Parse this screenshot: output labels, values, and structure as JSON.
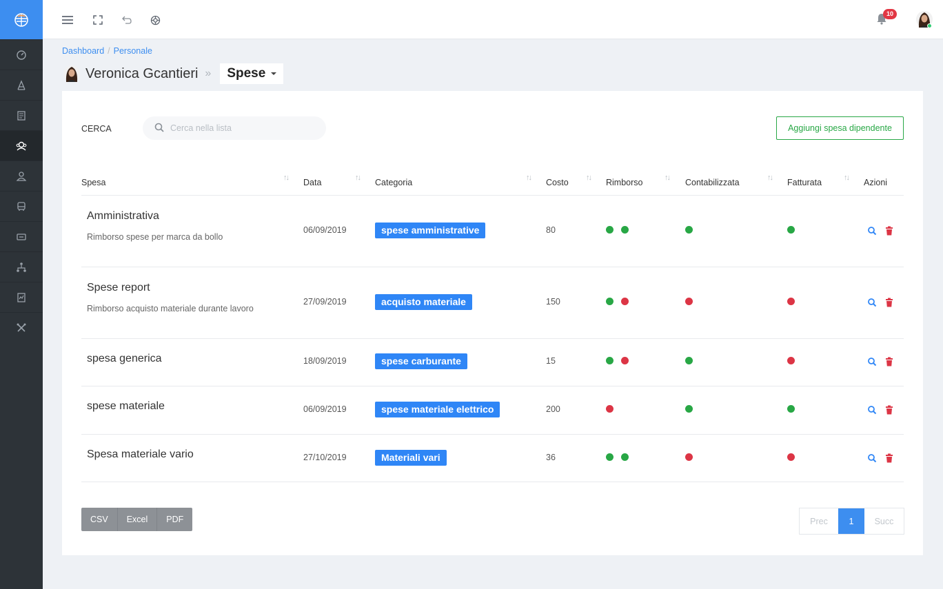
{
  "sidebar": {
    "logo": "logo-icon",
    "items": [
      {
        "icon": "dashboard-icon"
      },
      {
        "icon": "text-icon"
      },
      {
        "icon": "document-icon"
      },
      {
        "icon": "team-icon",
        "active": true
      },
      {
        "icon": "user-group-icon"
      },
      {
        "icon": "vehicle-icon"
      },
      {
        "icon": "ticket-icon"
      },
      {
        "icon": "network-icon"
      },
      {
        "icon": "report-icon"
      },
      {
        "icon": "tools-icon"
      }
    ]
  },
  "topbar": {
    "icons": [
      "menu-icon",
      "fullscreen-icon",
      "undo-icon",
      "globe-icon"
    ],
    "notification_count": "10"
  },
  "breadcrumb": {
    "home": "Dashboard",
    "sep": "/",
    "current": "Personale"
  },
  "title": {
    "name": "Veronica Gcantieri",
    "arrow": "»",
    "section": "Spese"
  },
  "search": {
    "label": "CERCA",
    "placeholder": "Cerca nella lista"
  },
  "add_button": "Aggiungi spesa dipendente",
  "table": {
    "headers": [
      "Spesa",
      "Data",
      "Categoria",
      "Costo",
      "Rimborso",
      "Contabilizzata",
      "Fatturata",
      "Azioni"
    ],
    "rows": [
      {
        "title": "Amministrativa",
        "subtitle": "Rimborso spese per marca da bollo",
        "date": "06/09/2019",
        "category": "spese amministrative",
        "cost": "80",
        "rimborso": [
          "green",
          "green"
        ],
        "contabilizzata": "green",
        "fatturata": "green"
      },
      {
        "title": "Spese report",
        "subtitle": "Rimborso acquisto materiale durante lavoro",
        "date": "27/09/2019",
        "category": "acquisto materiale",
        "cost": "150",
        "rimborso": [
          "green",
          "red"
        ],
        "contabilizzata": "red",
        "fatturata": "red"
      },
      {
        "title": "spesa generica",
        "subtitle": "",
        "date": "18/09/2019",
        "category": "spese carburante",
        "cost": "15",
        "rimborso": [
          "green",
          "red"
        ],
        "contabilizzata": "green",
        "fatturata": "red"
      },
      {
        "title": "spese materiale",
        "subtitle": "",
        "date": "06/09/2019",
        "category": "spese materiale elettrico",
        "cost": "200",
        "rimborso": [
          "red"
        ],
        "contabilizzata": "green",
        "fatturata": "green"
      },
      {
        "title": "Spesa materiale vario",
        "subtitle": "",
        "date": "27/10/2019",
        "category": "Materiali vari",
        "cost": "36",
        "rimborso": [
          "green",
          "green"
        ],
        "contabilizzata": "red",
        "fatturata": "red"
      }
    ]
  },
  "export": {
    "csv": "CSV",
    "excel": "Excel",
    "pdf": "PDF"
  },
  "pagination": {
    "prev": "Prec",
    "current": "1",
    "next": "Succ"
  },
  "colors": {
    "primary": "#3d8ef0",
    "success": "#28a745",
    "danger": "#dc3545",
    "sidebar": "#2d3338"
  }
}
